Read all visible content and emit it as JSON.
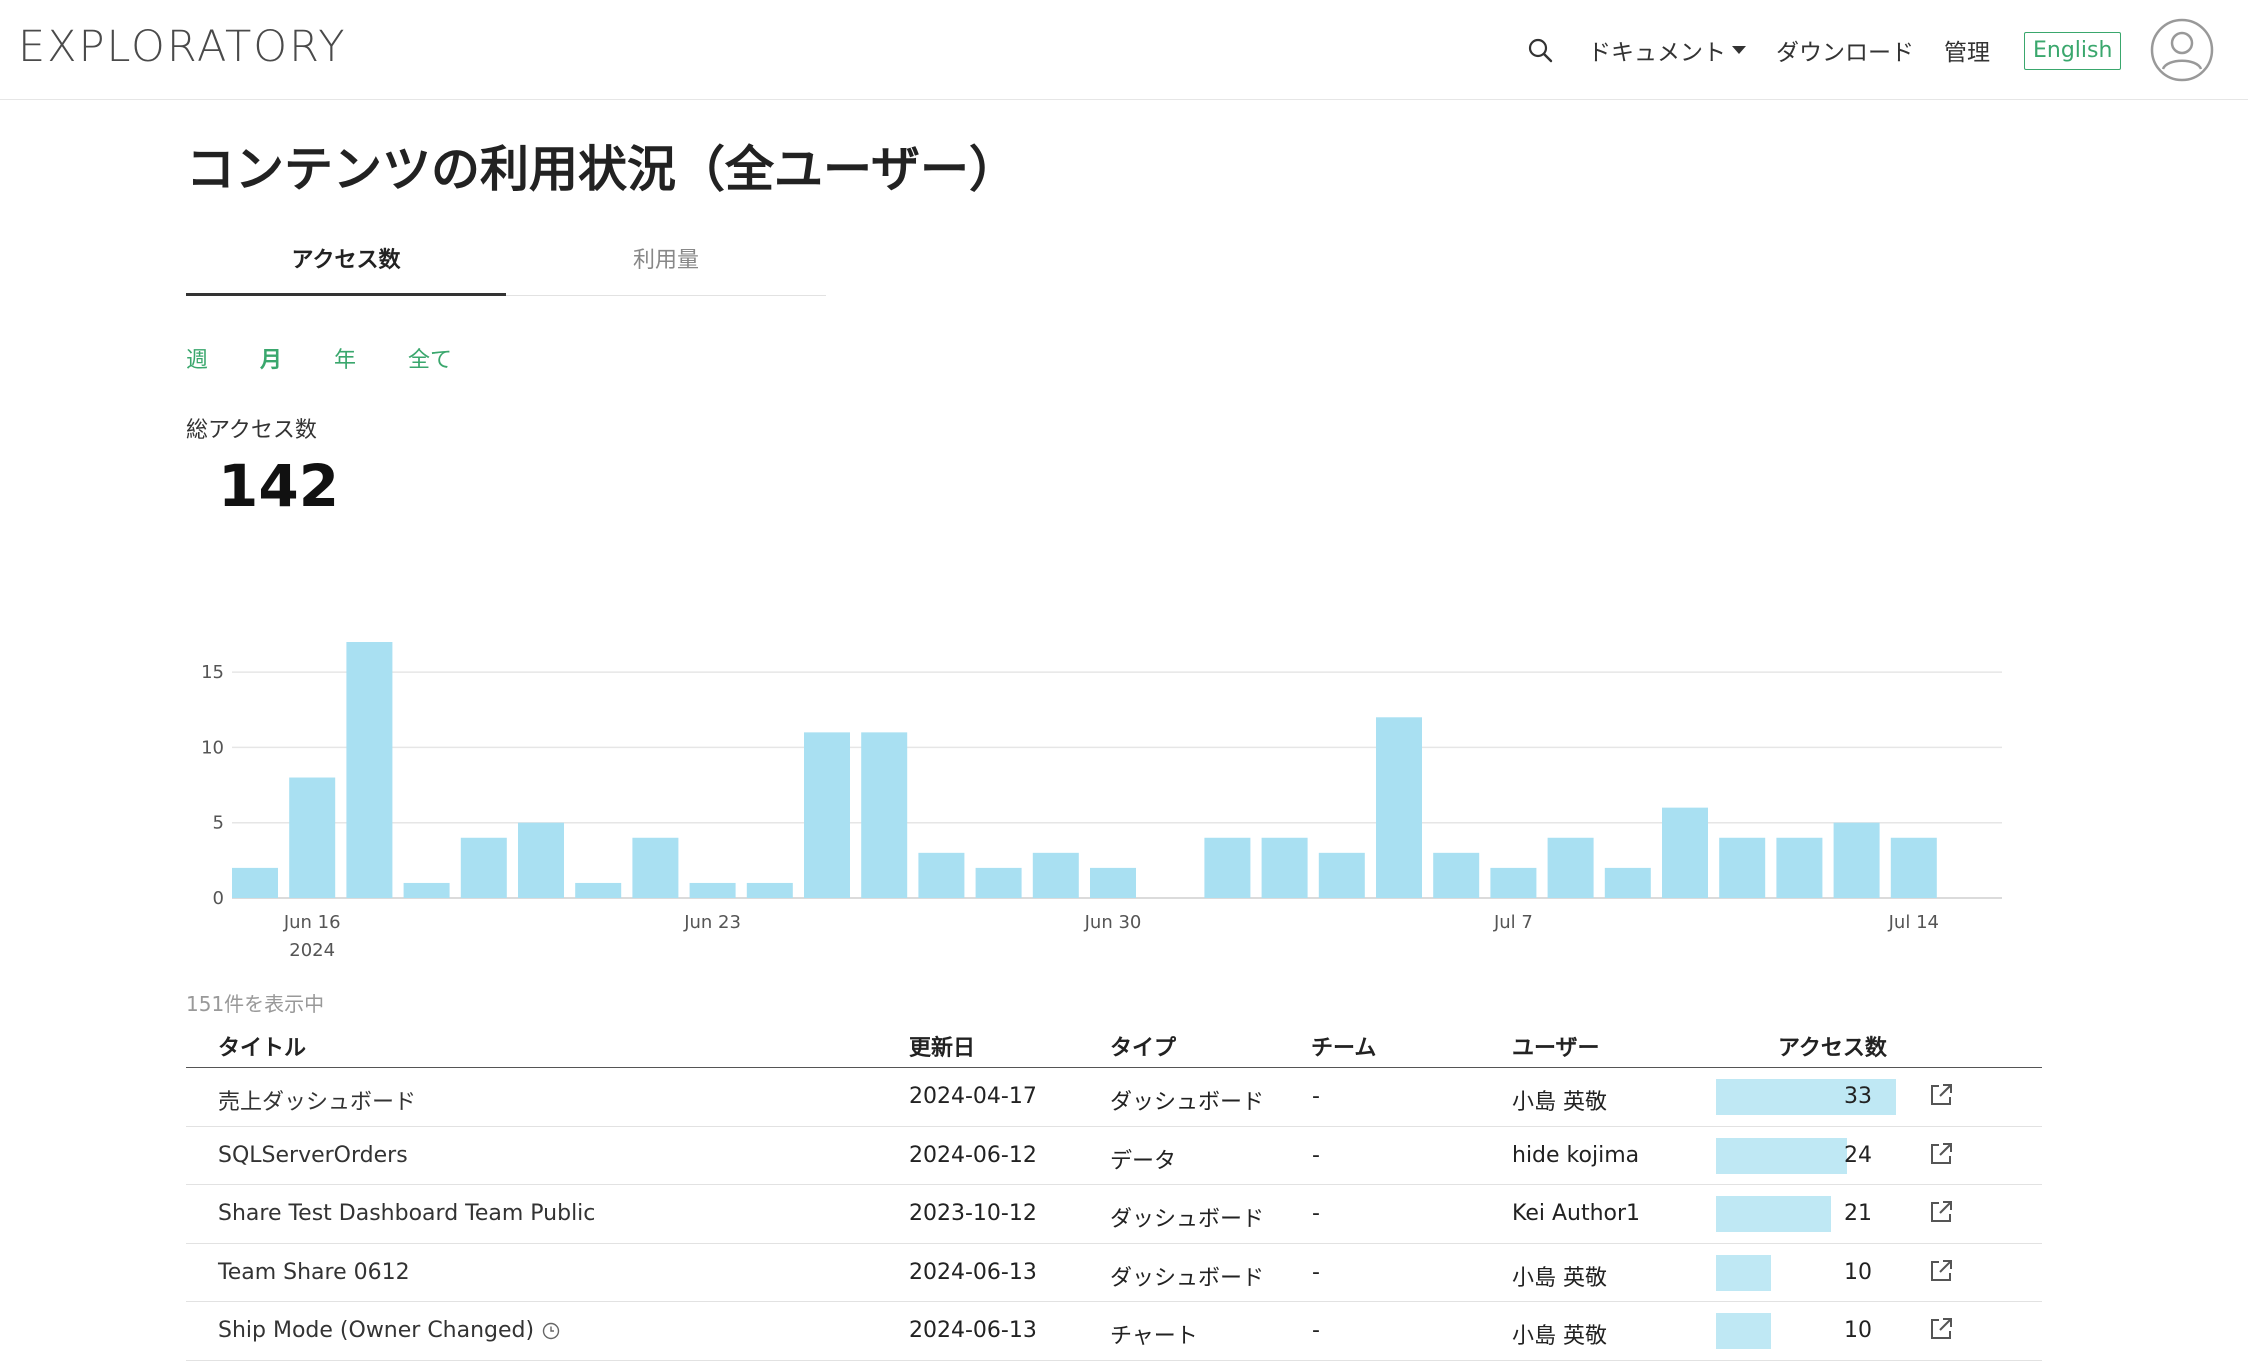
{
  "app": {
    "logo": "EXPLORATORY"
  },
  "nav": {
    "search_icon": "search-icon",
    "documents": "ドキュメント",
    "download": "ダウンロード",
    "admin": "管理",
    "language": "English",
    "avatar_icon": "user-avatar-icon"
  },
  "page": {
    "title": "コンテンツの利用状況（全ユーザー）"
  },
  "tabs": [
    {
      "label": "アクセス数",
      "active": true
    },
    {
      "label": "利用量",
      "active": false
    }
  ],
  "periods": [
    {
      "label": "週",
      "active": false
    },
    {
      "label": "月",
      "active": true
    },
    {
      "label": "年",
      "active": false
    },
    {
      "label": "全て",
      "active": false
    }
  ],
  "summary": {
    "label": "総アクセス数",
    "value": "142"
  },
  "colors": {
    "accent": "#3aa76d",
    "bar": "#a9e0f2",
    "access_bar": "#bfe8f4"
  },
  "chart_data": {
    "type": "bar",
    "x_ticks": [
      {
        "label": "Jun 16",
        "sublabel": "2024",
        "index": 1
      },
      {
        "label": "Jun 23",
        "sublabel": "",
        "index": 8
      },
      {
        "label": "Jun 30",
        "sublabel": "",
        "index": 15
      },
      {
        "label": "Jul 7",
        "sublabel": "",
        "index": 22
      },
      {
        "label": "Jul 14",
        "sublabel": "",
        "index": 29
      }
    ],
    "dates": [
      "2024-06-15",
      "2024-06-16",
      "2024-06-17",
      "2024-06-18",
      "2024-06-19",
      "2024-06-20",
      "2024-06-21",
      "2024-06-22",
      "2024-06-23",
      "2024-06-24",
      "2024-06-25",
      "2024-06-26",
      "2024-06-27",
      "2024-06-28",
      "2024-06-29",
      "2024-06-30",
      "2024-07-01",
      "2024-07-02",
      "2024-07-03",
      "2024-07-04",
      "2024-07-05",
      "2024-07-06",
      "2024-07-07",
      "2024-07-08",
      "2024-07-09",
      "2024-07-10",
      "2024-07-11",
      "2024-07-12",
      "2024-07-13",
      "2024-07-14"
    ],
    "values": [
      2,
      8,
      17,
      1,
      4,
      5,
      1,
      4,
      1,
      1,
      11,
      11,
      3,
      2,
      3,
      2,
      0,
      4,
      4,
      3,
      12,
      3,
      2,
      4,
      2,
      6,
      4,
      4,
      5,
      4
    ],
    "y_ticks": [
      0,
      5,
      10,
      15
    ],
    "ylim": [
      0,
      17
    ],
    "grid": true
  },
  "table": {
    "count_note": "151件を表示中",
    "headers": {
      "title": "タイトル",
      "updated": "更新日",
      "type": "タイプ",
      "team": "チーム",
      "user": "ユーザー",
      "access": "アクセス数"
    },
    "max_access": 33,
    "rows": [
      {
        "title": "売上ダッシュボード",
        "updated": "2024-04-17",
        "type": "ダッシュボード",
        "team": "-",
        "user": "小島 英敬",
        "access": 33,
        "has_clock": false
      },
      {
        "title": "SQLServerOrders",
        "updated": "2024-06-12",
        "type": "データ",
        "team": "-",
        "user": "hide kojima",
        "access": 24,
        "has_clock": false
      },
      {
        "title": "Share Test Dashboard Team Public",
        "updated": "2023-10-12",
        "type": "ダッシュボード",
        "team": "-",
        "user": "Kei Author1",
        "access": 21,
        "has_clock": false
      },
      {
        "title": "Team Share 0612",
        "updated": "2024-06-13",
        "type": "ダッシュボード",
        "team": "-",
        "user": "小島 英敬",
        "access": 10,
        "has_clock": false
      },
      {
        "title": "Ship Mode (Owner Changed)",
        "updated": "2024-06-13",
        "type": "チャート",
        "team": "-",
        "user": "小島 英敬",
        "access": 10,
        "has_clock": true
      }
    ]
  }
}
